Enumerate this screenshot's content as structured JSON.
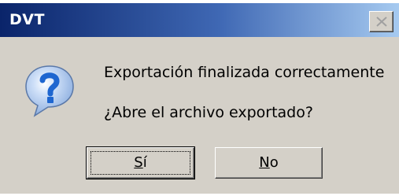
{
  "window": {
    "title": "DVT",
    "close_icon": "close-x-icon"
  },
  "dialog": {
    "icon": "question-icon",
    "message": "Exportación finalizada correctamente",
    "question": "¿Abre el archivo exportado?"
  },
  "buttons": {
    "yes_label": "Sí",
    "no_label": "No"
  },
  "colors": {
    "titlebar_start": "#0a246a",
    "titlebar_end": "#a6caf0",
    "dialog_bg": "#d4d0c8",
    "icon_blue": "#1e66d0"
  }
}
